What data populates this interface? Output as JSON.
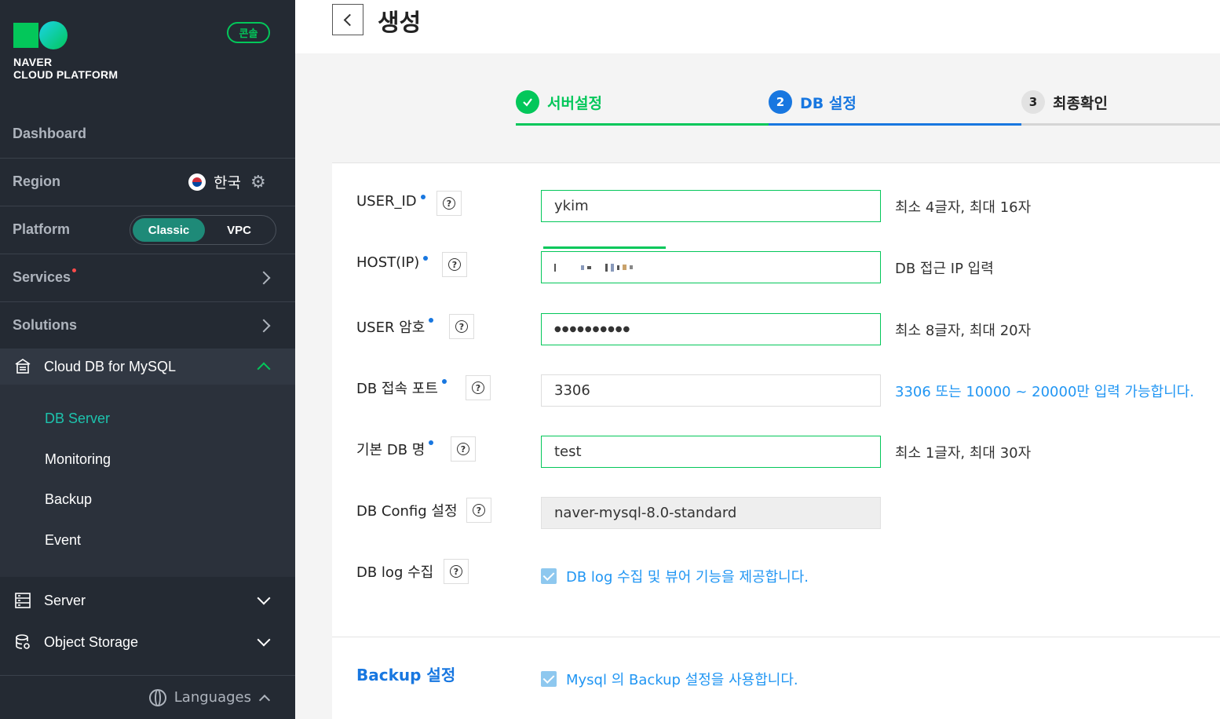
{
  "sidebar": {
    "logo_line1": "NAVER",
    "logo_line2": "CLOUD PLATFORM",
    "console_badge": "콘솔",
    "dashboard": "Dashboard",
    "region_label": "Region",
    "region_value": "한국",
    "platform_label": "Platform",
    "platform_options": [
      "Classic",
      "VPC"
    ],
    "platform_selected": "Classic",
    "services": "Services",
    "solutions": "Solutions",
    "cloud_db": "Cloud DB for MySQL",
    "sub_items": [
      "DB Server",
      "Monitoring",
      "Backup",
      "Event"
    ],
    "sub_active": "DB Server",
    "server": "Server",
    "object_storage": "Object Storage",
    "languages": "Languages"
  },
  "header": {
    "title": "생성"
  },
  "steps": [
    {
      "label": "서버설정",
      "state": "done"
    },
    {
      "number": "2",
      "label": "DB 설정",
      "state": "active"
    },
    {
      "number": "3",
      "label": "최종확인",
      "state": "pending"
    }
  ],
  "form": {
    "user_id": {
      "label": "USER_ID",
      "value": "ykim",
      "hint": "최소 4글자, 최대 16자"
    },
    "host": {
      "label": "HOST(IP)",
      "hint": "DB 접근 IP 입력"
    },
    "password": {
      "label": "USER 암호",
      "value": "●●●●●●●●●●",
      "hint": "최소 8글자, 최대 20자"
    },
    "port": {
      "label": "DB 접속 포트",
      "value": "3306",
      "hint": "3306 또는 10000 ~ 20000만 입력 가능합니다."
    },
    "db_name": {
      "label": "기본 DB 명",
      "value": "test",
      "hint": "최소 1글자, 최대 30자"
    },
    "db_config": {
      "label": "DB Config 설정",
      "value": "naver-mysql-8.0-standard"
    },
    "db_log": {
      "label": "DB log 수집",
      "checkbox_label": "DB log 수집 및 뷰어 기능을 제공합니다."
    }
  },
  "backup": {
    "title": "Backup 설정",
    "checkbox_label": "Mysql 의 Backup 설정을 사용합니다."
  },
  "colors": {
    "sidebar_bg": "#242a33",
    "brand_green": "#03c75a",
    "active_blue": "#1877e0",
    "hint_blue": "#2196f3"
  }
}
